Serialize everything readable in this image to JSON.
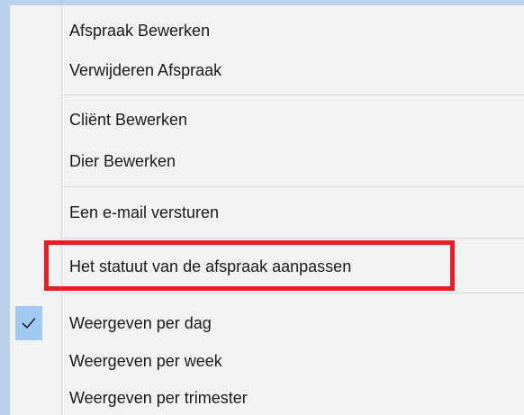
{
  "menu": {
    "items": [
      {
        "label": "Afspraak Bewerken"
      },
      {
        "label": "Verwijderen Afspraak"
      },
      {
        "label": "Cliënt Bewerken"
      },
      {
        "label": "Dier Bewerken"
      },
      {
        "label": "Een e-mail versturen"
      },
      {
        "label": "Het statuut van de afspraak aanpassen",
        "highlighted": true
      },
      {
        "label": "Weergeven per dag",
        "checked": true
      },
      {
        "label": "Weergeven per week"
      },
      {
        "label": "Weergeven per trimester"
      }
    ]
  },
  "colors": {
    "highlight_border": "#e32027",
    "check_background": "#9fcaf1",
    "menu_background": "#f2f2f2",
    "window_strip": "#b9d1ea"
  },
  "icons": {
    "check": "check-icon"
  }
}
